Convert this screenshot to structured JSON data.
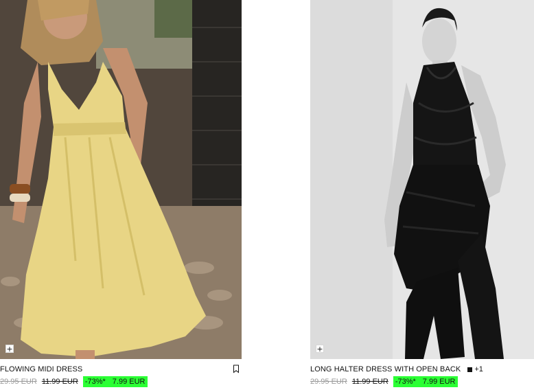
{
  "products": [
    {
      "name": "FLOWING MIDI DRESS",
      "price_original": "29.95 EUR",
      "price_previous": "11.99 EUR",
      "discount": "-73%*",
      "price_current": "7.99 EUR",
      "add_icon": "plus-icon",
      "bookmark_icon": "bookmark-icon",
      "colors": []
    },
    {
      "name": "LONG HALTER DRESS WITH OPEN BACK",
      "price_original": "29.95 EUR",
      "price_previous": "11.99 EUR",
      "discount": "-73%*",
      "price_current": "7.99 EUR",
      "add_icon": "plus-icon",
      "colors": [
        "#111111"
      ],
      "more_colors": "+1"
    }
  ],
  "theme": {
    "sale_highlight": "#2bff34",
    "text": "#111111",
    "strike_muted": "#9a9a9a"
  }
}
